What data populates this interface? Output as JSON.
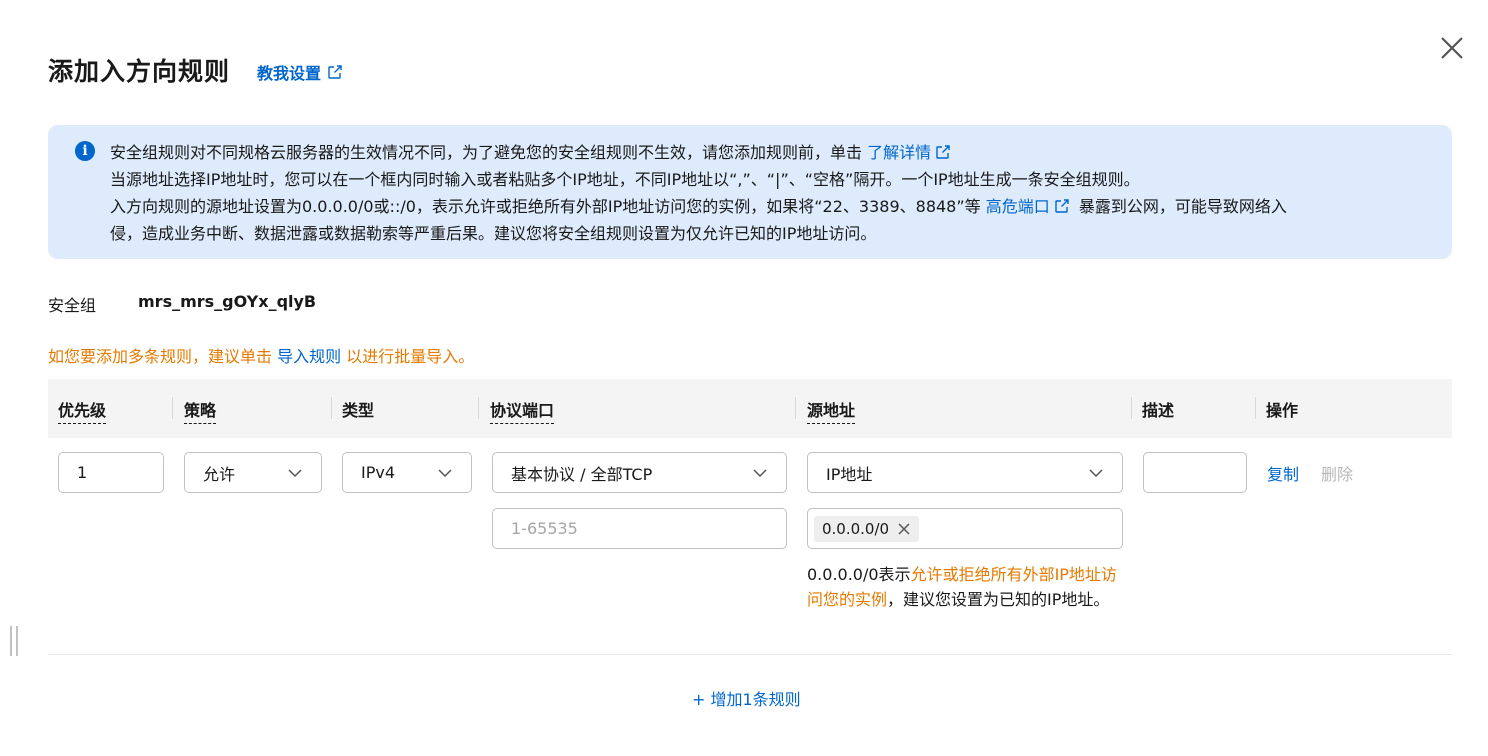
{
  "header": {
    "title": "添加入方向规则",
    "teach_link": "教我设置"
  },
  "notice": {
    "line1": "安全组规则对不同规格云服务器的生效情况不同，为了避免您的安全组规则不生效，请您添加规则前，单击",
    "line1_link": "了解详情",
    "line2": "当源地址选择IP地址时，您可以在一个框内同时输入或者粘贴多个IP地址，不同IP地址以“,”、“|”、“空格”隔开。一个IP地址生成一条安全组规则。",
    "line3_a": "入方向规则的源地址设置为0.0.0.0/0或::/0，表示允许或拒绝所有外部IP地址访问您的实例，如果将“22、3389、8848”等",
    "line3_link": "高危端口",
    "line3_b": "暴露到公网，可能导致网络入",
    "line4": "侵，造成业务中断、数据泄露或数据勒索等严重后果。建议您将安全组规则设置为仅允许已知的IP地址访问。"
  },
  "security_group": {
    "label": "安全组",
    "value": "mrs_mrs_gOYx_qlyB"
  },
  "tip": {
    "prefix": "如您要添加多条规则，建议单击",
    "link": "导入规则",
    "suffix": "以进行批量导入。"
  },
  "table": {
    "headers": {
      "priority": "优先级",
      "policy": "策略",
      "type": "类型",
      "protocol_port": "协议端口",
      "source": "源地址",
      "description": "描述",
      "action": "操作"
    },
    "row": {
      "priority": "1",
      "policy": "允许",
      "type": "IPv4",
      "protocol": "基本协议 / 全部TCP",
      "port_placeholder": "1-65535",
      "source_type": "IP地址",
      "source_tag": "0.0.0.0/0",
      "description": "",
      "copy": "复制",
      "delete": "删除"
    },
    "hint": {
      "a": "0.0.0.0/0表示",
      "warn": "允许或拒绝所有外部IP地址访问您的实例",
      "b": "，建议您设置为已知的IP地址。"
    }
  },
  "add_rule": "+ 增加1条规则",
  "colors": {
    "accent": "#0066cc",
    "warning": "#e57a00",
    "notice_bg": "#deebfc"
  }
}
